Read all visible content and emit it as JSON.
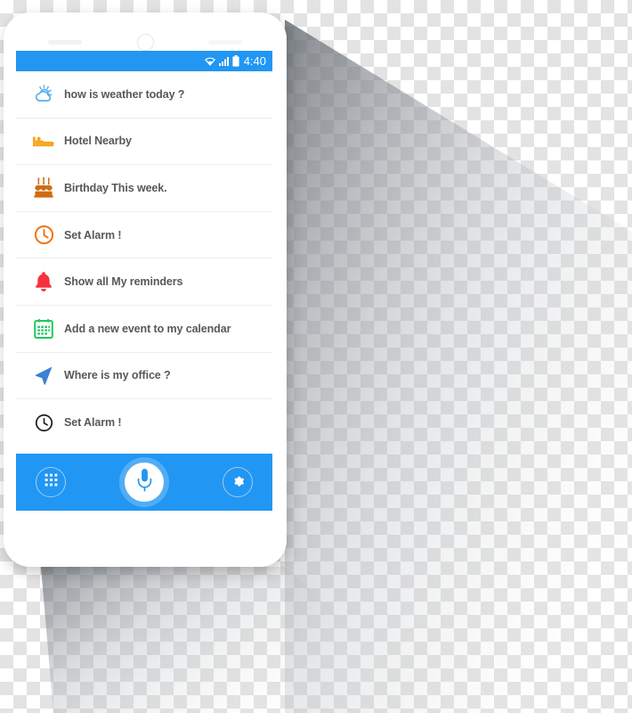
{
  "device": {
    "type": "smartphone-mockup",
    "body_color": "#ffffff",
    "camera_icon": "camera-icon",
    "speaker_icon": "speaker-grill-icon"
  },
  "status_bar": {
    "background": "#2196f3",
    "time": "4:40",
    "icons": [
      "wifi-icon",
      "signal-bars-icon",
      "battery-icon"
    ]
  },
  "suggestions": {
    "items": [
      {
        "icon": "weather-partly-cloudy-icon",
        "color": "#5aafec",
        "label": "how is weather today ?"
      },
      {
        "icon": "bed-hotel-icon",
        "color": "#f5a623",
        "label": "Hotel Nearby"
      },
      {
        "icon": "birthday-cake-icon",
        "color": "#cf6c12",
        "label": "Birthday This week."
      },
      {
        "icon": "alarm-clock-icon",
        "color": "#f07818",
        "label": "Set Alarm !"
      },
      {
        "icon": "bell-reminder-icon",
        "color": "#f5333f",
        "label": "Show all My reminders"
      },
      {
        "icon": "calendar-add-icon",
        "color": "#1ec95b",
        "label": "Add a new event to my calendar"
      },
      {
        "icon": "navigation-arrow-icon",
        "color": "#3d7fd6",
        "label": "Where is my office ?"
      },
      {
        "icon": "clock-icon",
        "color": "#1d1d1d",
        "label": "Set Alarm !"
      }
    ]
  },
  "bottom_bar": {
    "background": "#2196f3",
    "apps_button": {
      "icon": "apps-grid-icon",
      "label": "Apps"
    },
    "mic_button": {
      "icon": "microphone-icon",
      "label": "Voice search"
    },
    "settings_button": {
      "icon": "gear-icon",
      "label": "Settings"
    }
  },
  "colors": {
    "accent_blue": "#2196f3",
    "text_gray": "#585858",
    "divider": "#ededed",
    "checker_light": "#ffffff",
    "checker_dark": "#e3e3e3"
  }
}
